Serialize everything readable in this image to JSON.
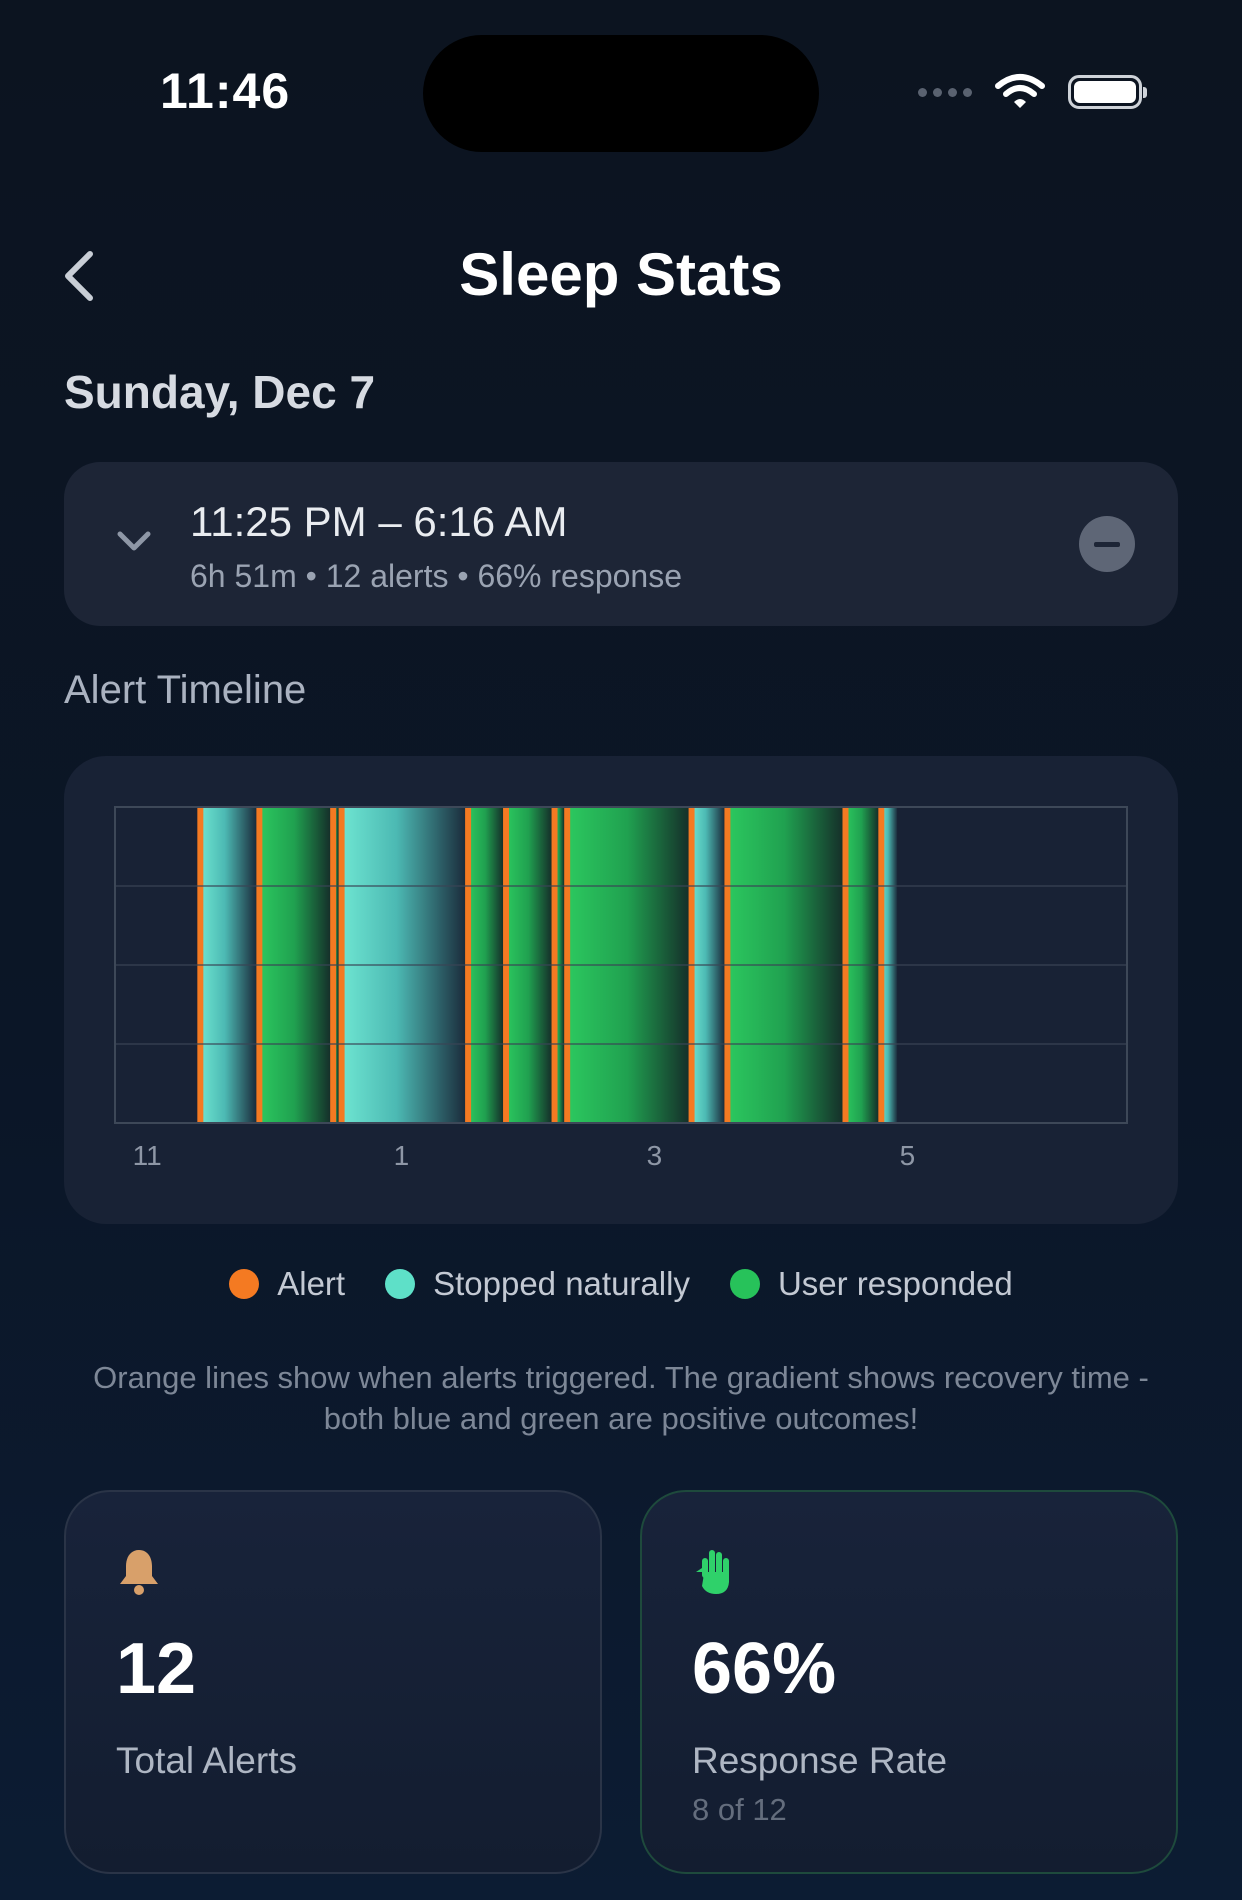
{
  "status_bar": {
    "time": "11:46"
  },
  "header": {
    "title": "Sleep Stats"
  },
  "date": "Sunday, Dec 7",
  "session": {
    "time_range": "11:25 PM – 6:16 AM",
    "meta": "6h 51m • 12 alerts • 66% response"
  },
  "timeline": {
    "label": "Alert Timeline",
    "chart_data": {
      "type": "timeline",
      "x_unit": "hour",
      "x_range": [
        22.75,
        6.75
      ],
      "x_ticks": [
        "11",
        "1",
        "3",
        "5"
      ],
      "events": [
        {
          "start": "11:25",
          "end": "11:52",
          "outcome": "stopped"
        },
        {
          "start": "11:53",
          "end": "12:27",
          "outcome": "responded"
        },
        {
          "start": "12:28",
          "end": "12:31",
          "outcome": "responded"
        },
        {
          "start": "12:32",
          "end": "1:31",
          "outcome": "stopped"
        },
        {
          "start": "1:32",
          "end": "1:49",
          "outcome": "responded"
        },
        {
          "start": "1:50",
          "end": "2:12",
          "outcome": "responded"
        },
        {
          "start": "2:13",
          "end": "2:18",
          "outcome": "responded"
        },
        {
          "start": "2:19",
          "end": "3:17",
          "outcome": "responded"
        },
        {
          "start": "3:18",
          "end": "3:34",
          "outcome": "stopped"
        },
        {
          "start": "3:35",
          "end": "4:30",
          "outcome": "responded"
        },
        {
          "start": "4:31",
          "end": "4:47",
          "outcome": "responded"
        },
        {
          "start": "4:48",
          "end": "4:56",
          "outcome": "stopped"
        }
      ]
    },
    "legend": [
      {
        "label": "Alert",
        "color": "#f47a22"
      },
      {
        "label": "Stopped naturally",
        "color": "#5ee0c8"
      },
      {
        "label": "User responded",
        "color": "#27c25a"
      }
    ],
    "note": "Orange lines show when alerts triggered. The gradient shows recovery time - both blue and green are positive outcomes!"
  },
  "stats": {
    "alerts": {
      "icon": "bell-icon",
      "value": "12",
      "label": "Total Alerts"
    },
    "response": {
      "icon": "hand-icon",
      "value": "66%",
      "label": "Response Rate",
      "sub": "8 of 12"
    }
  }
}
